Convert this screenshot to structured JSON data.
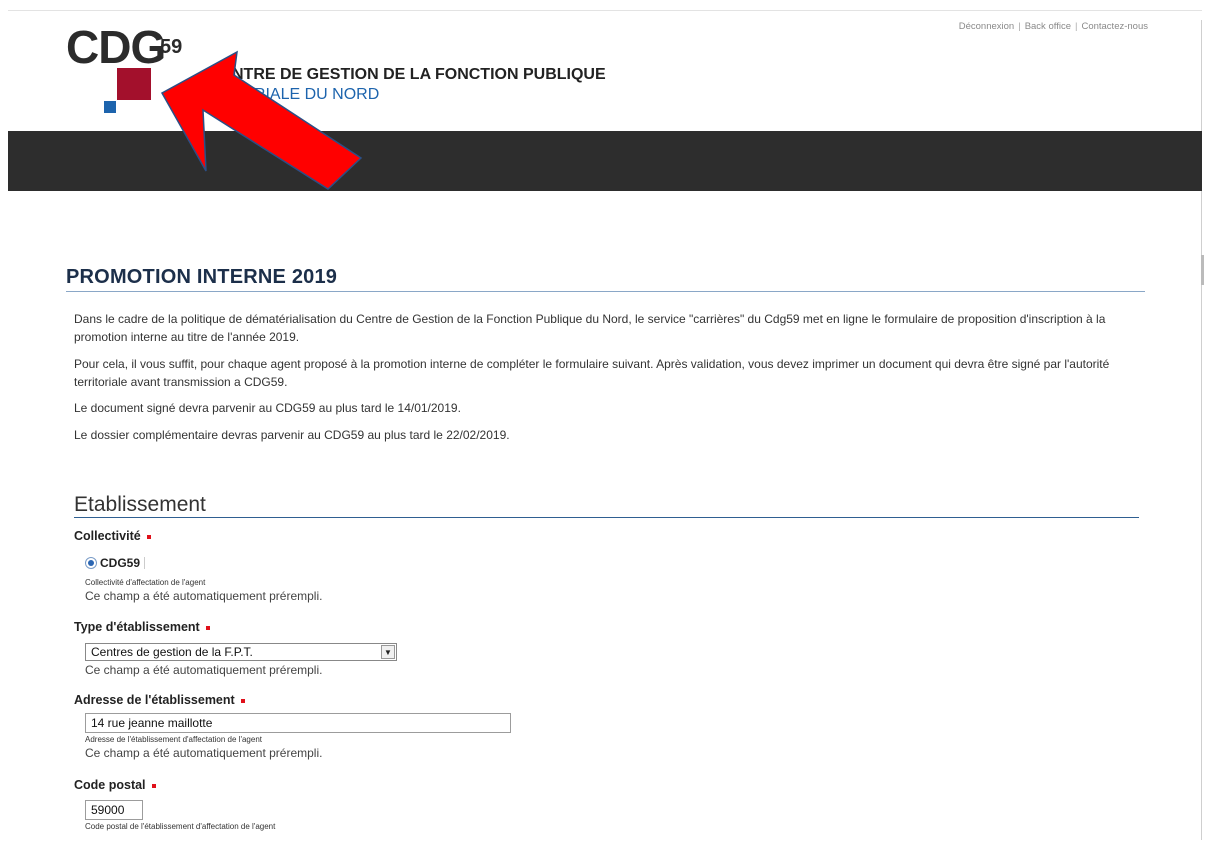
{
  "header": {
    "links": [
      "Déconnexion",
      "Back office",
      "Contactez-nous"
    ],
    "logo_text": "CDG",
    "logo_sup": "59",
    "org_line1": "NTRE DE GESTION DE LA FONCTION PUBLIQUE",
    "org_line2": "TORIALE DU NORD"
  },
  "colors": {
    "dark_band": "#2d2d2d",
    "logo_red": "#a3102c",
    "logo_blue": "#1d64ad",
    "arrow_red": "#ff0000",
    "title_navy": "#1c2f4a"
  },
  "page": {
    "title": "PROMOTION INTERNE 2019",
    "intro": [
      "Dans le cadre de la politique de dématérialisation du Centre de Gestion de la Fonction Publique du Nord, le service \"carrières\" du Cdg59 met en ligne le formulaire de proposition d'inscription à la promotion interne au titre de l'année 2019.",
      "Pour cela, il vous suffit, pour chaque agent proposé à la promotion interne de compléter le formulaire suivant. Après validation, vous devez imprimer un document qui devra être signé par l'autorité territoriale avant transmission a CDG59.",
      "Le document signé devra parvenir au CDG59 au plus tard le 14/01/2019.",
      "Le dossier complémentaire devras parvenir au CDG59 au plus tard le 22/02/2019."
    ]
  },
  "form": {
    "section_title": "Etablissement",
    "autofill_note": "Ce champ a été automatiquement prérempli.",
    "collectivite": {
      "label": "Collectivité",
      "option": "CDG59",
      "help": "Collectivité d'affectation de l'agent"
    },
    "type": {
      "label": "Type d'établissement",
      "value": "Centres de gestion de la F.P.T."
    },
    "adresse": {
      "label": "Adresse de l'établissement",
      "value": "14 rue jeanne maillotte",
      "help": "Adresse de l'établissement d'affectation de l'agent"
    },
    "code_postal": {
      "label": "Code postal",
      "value": "59000",
      "help": "Code postal de l'établissement d'affectation de l'agent"
    }
  },
  "overlay": {
    "annotation": "red-arrow-icon"
  }
}
